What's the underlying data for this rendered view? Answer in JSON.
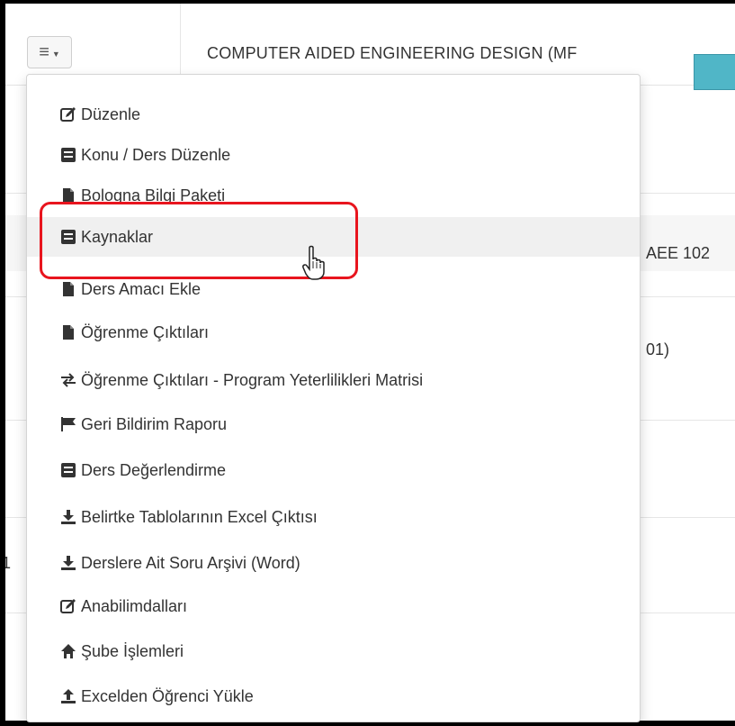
{
  "header": {
    "course_title": "COMPUTER AIDED ENGINEERING DESIGN (MF"
  },
  "background_rows": {
    "code_fragment": "AEE 102",
    "paren_fragment": "01)",
    "left_fragment": "1"
  },
  "menu": {
    "items": [
      {
        "label": "Düzenle",
        "icon": "edit-icon"
      },
      {
        "label": "Konu / Ders Düzenle",
        "icon": "book-icon"
      },
      {
        "label": "Bologna Bilgi Paketi",
        "icon": "file-icon"
      },
      {
        "label": "Kaynaklar",
        "icon": "book-icon"
      },
      {
        "label": "Ders Amacı Ekle",
        "icon": "file-icon"
      },
      {
        "label": "Öğrenme Çıktıları",
        "icon": "file-icon"
      },
      {
        "label": "Öğrenme Çıktıları - Program Yeterlilikleri Matrisi",
        "icon": "exchange-icon"
      },
      {
        "label": "Geri Bildirim Raporu",
        "icon": "flag-icon"
      },
      {
        "label": "Ders Değerlendirme",
        "icon": "book-icon"
      },
      {
        "label": "Belirtke Tablolarının Excel Çıktısı",
        "icon": "download-icon"
      },
      {
        "label": "Derslere Ait Soru Arşivi (Word)",
        "icon": "download-icon"
      },
      {
        "label": "Anabilimdalları",
        "icon": "edit-icon"
      },
      {
        "label": "Şube İşlemleri",
        "icon": "home-icon"
      },
      {
        "label": "Excelden Öğrenci Yükle",
        "icon": "upload-icon"
      }
    ],
    "active_index": 3
  },
  "colors": {
    "highlight": "#e8151e",
    "teal_button": "#50b6c7",
    "text": "#333333"
  }
}
